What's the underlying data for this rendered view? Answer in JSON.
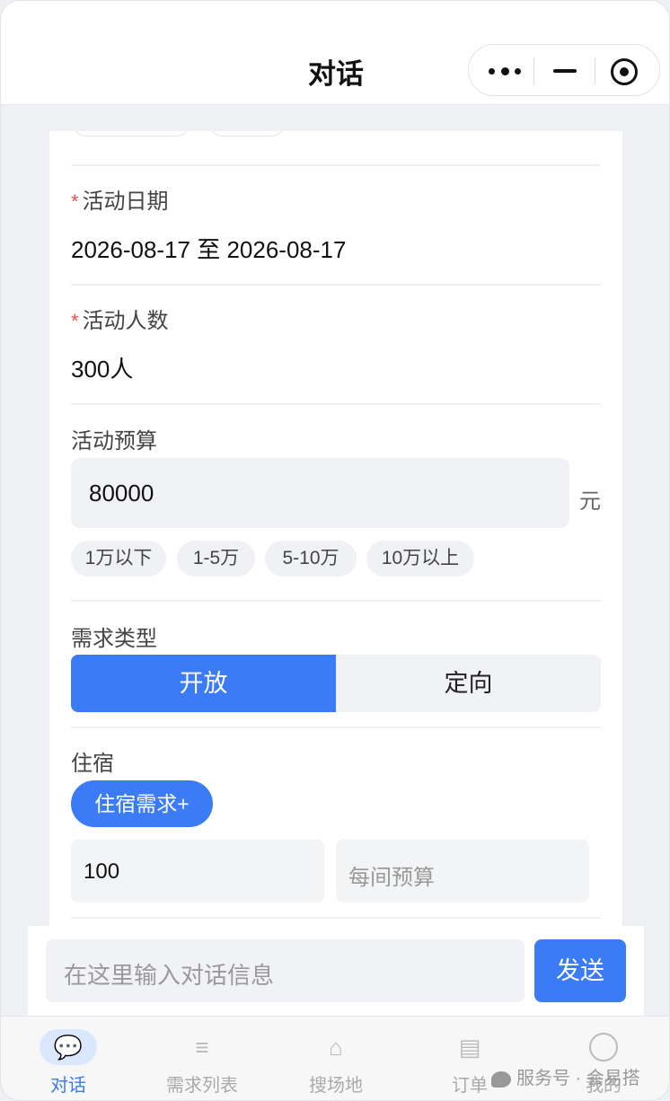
{
  "header": {
    "title": "对话"
  },
  "form": {
    "date": {
      "label": "活动日期",
      "required_mark": "*",
      "value": "2026-08-17 至 2026-08-17"
    },
    "people": {
      "label": "活动人数",
      "required_mark": "*",
      "value": "300人"
    },
    "budget": {
      "label": "活动预算",
      "value": "80000",
      "unit": "元",
      "chips": [
        "1万以下",
        "1-5万",
        "5-10万",
        "10万以上"
      ]
    },
    "demand_type": {
      "label": "需求类型",
      "options": [
        "开放",
        "定向"
      ],
      "selected": "开放"
    },
    "lodging": {
      "label": "住宿",
      "add_button": "住宿需求+",
      "rooms_value": "100",
      "room_budget_placeholder": "每间预算"
    }
  },
  "chat": {
    "placeholder": "在这里输入对话信息",
    "send_label": "发送"
  },
  "tabs": [
    {
      "label": "对话",
      "icon": "chat-bubble-icon",
      "glyph": "💬",
      "active": true
    },
    {
      "label": "需求列表",
      "icon": "list-icon",
      "glyph": "≡"
    },
    {
      "label": "搜场地",
      "icon": "home-icon",
      "glyph": "⌂"
    },
    {
      "label": "订单",
      "icon": "document-icon",
      "glyph": "▤"
    },
    {
      "label": "我的",
      "icon": "user-circle-icon",
      "glyph": ""
    }
  ],
  "watermark": {
    "text": "服务号 · 会易搭"
  },
  "colors": {
    "accent": "#3b7bf6",
    "required": "#f24b4b"
  }
}
